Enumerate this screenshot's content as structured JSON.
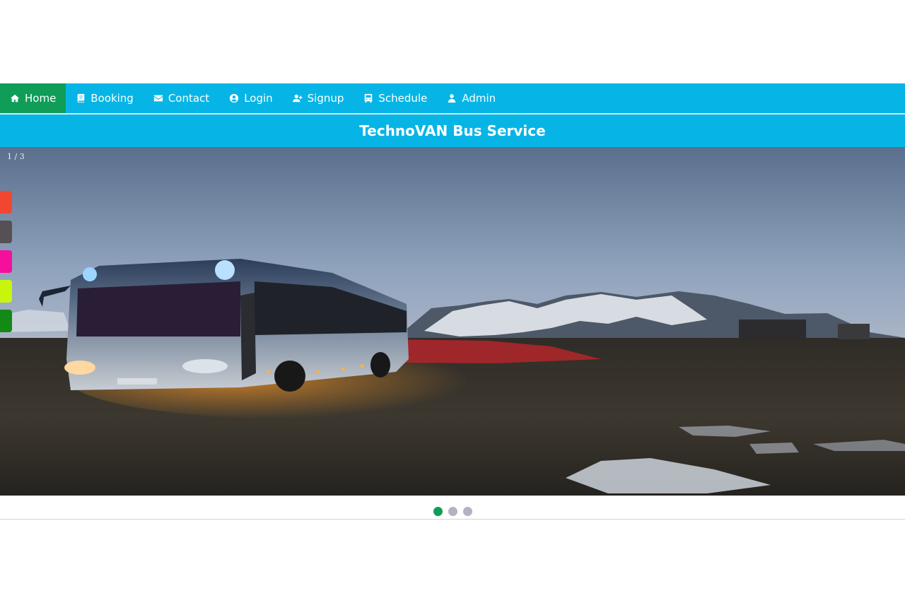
{
  "nav": {
    "items": [
      {
        "label": "Home",
        "icon": "home-icon"
      },
      {
        "label": "Booking",
        "icon": "book-icon"
      },
      {
        "label": "Contact",
        "icon": "envelope-icon"
      },
      {
        "label": "Login",
        "icon": "user-circle-icon"
      },
      {
        "label": "Signup",
        "icon": "user-plus-icon"
      },
      {
        "label": "Schedule",
        "icon": "bus-icon"
      },
      {
        "label": "Admin",
        "icon": "user-icon"
      }
    ],
    "active": "Home",
    "colors": {
      "bar": "#06b5e6",
      "active": "#0f9d58"
    }
  },
  "header": {
    "title": "TechnoVAN Bus Service"
  },
  "slider": {
    "counter": "1 / 3",
    "current": 1,
    "total": 3,
    "image": "bus-at-night-snowy-mountains-image"
  },
  "social_tabs": [
    {
      "name": "social-tab-red",
      "color": "#f24633"
    },
    {
      "name": "social-tab-gray",
      "color": "#555053"
    },
    {
      "name": "social-tab-pink",
      "color": "#f50f9d"
    },
    {
      "name": "social-tab-lime",
      "color": "#c7f50c"
    },
    {
      "name": "social-tab-green",
      "color": "#128a15"
    }
  ]
}
